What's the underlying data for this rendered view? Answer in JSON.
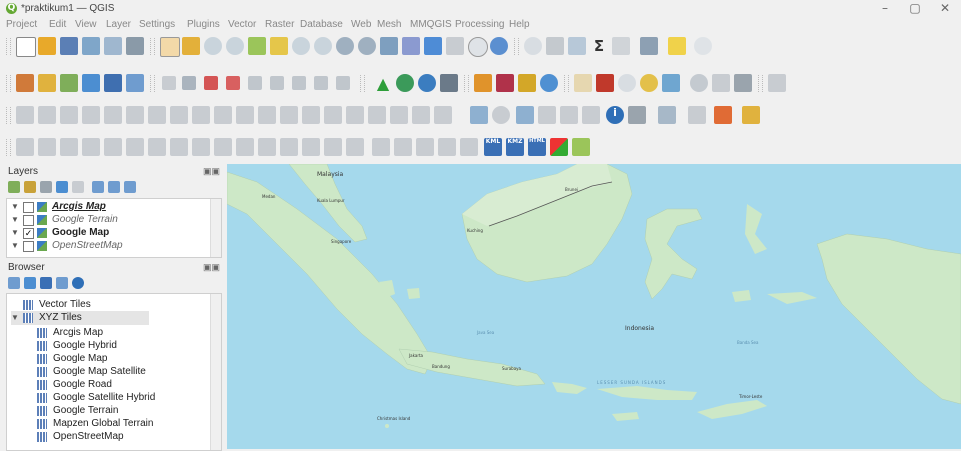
{
  "window": {
    "title": "*praktikum1 — QGIS",
    "app_logo": "qgis-logo-icon",
    "controls": [
      "–",
      "▢",
      "✕"
    ]
  },
  "menubar": {
    "items": [
      "Project",
      "Edit",
      "View",
      "Layer",
      "Settings",
      "Plugins",
      "Vector",
      "Raster",
      "Database",
      "Web",
      "Mesh",
      "MMQGIS",
      "Processing",
      "Help"
    ]
  },
  "toolbars": {
    "row4_labels": [
      "KML",
      "KMZ",
      "HTML"
    ]
  },
  "layers_panel": {
    "title": "Layers",
    "controls": "▣▣",
    "layers": [
      {
        "name": "Arcgis Map",
        "checked": false,
        "style": "bold-italic-underline"
      },
      {
        "name": "Google Terrain",
        "checked": false,
        "style": "italic"
      },
      {
        "name": "Google Map",
        "checked": true,
        "style": "bold"
      },
      {
        "name": "OpenStreetMap",
        "checked": false,
        "style": "italic"
      }
    ],
    "check_mark": "✓"
  },
  "browser_panel": {
    "title": "Browser",
    "controls": "▣▣",
    "items": [
      {
        "name": "Vector Tiles",
        "level": 1
      },
      {
        "name": "XYZ Tiles",
        "level": 0,
        "expanded": true
      },
      {
        "name": "Arcgis Map",
        "level": 2
      },
      {
        "name": "Google Hybrid",
        "level": 2
      },
      {
        "name": "Google Map",
        "level": 2
      },
      {
        "name": "Google Map Satellite",
        "level": 2
      },
      {
        "name": "Google Road",
        "level": 2
      },
      {
        "name": "Google Satellite Hybrid",
        "level": 2
      },
      {
        "name": "Google Terrain",
        "level": 2
      },
      {
        "name": "Mapzen Global Terrain",
        "level": 2
      },
      {
        "name": "OpenStreetMap",
        "level": 2
      }
    ]
  },
  "map": {
    "labels": {
      "malaysia": "Malaysia",
      "kuala_lumpur": "Kuala Lumpur",
      "singapore": "Singapore",
      "brunei": "Brunei",
      "kuching": "Kuching",
      "indonesia": "Indonesia",
      "jakarta": "Jakarta",
      "bandung": "Bandung",
      "surabaya": "Surabaya",
      "timor_leste": "Timor-Leste",
      "christmas_island": "Christmas Island",
      "medan": "Medan",
      "java_sea": "Java Sea",
      "banda_sea": "Banda Sea",
      "sunda_islands": "LESSER SUNDA ISLANDS"
    },
    "colors": {
      "water": "#a5d9ec",
      "land": "#cde8c7",
      "land_dark": "#b9ddb0",
      "border": "#555555"
    }
  }
}
